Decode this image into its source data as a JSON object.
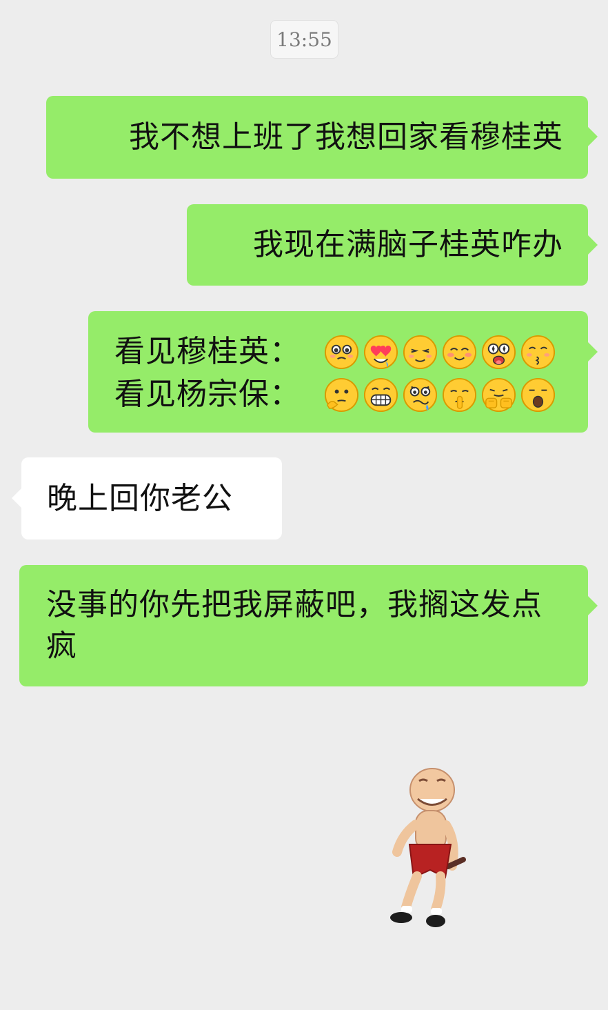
{
  "chat": {
    "timestamp": "13:55",
    "messages": [
      {
        "side": "outgoing",
        "text": "我不想上班了我想回家看穆桂英"
      },
      {
        "side": "outgoing",
        "text": "我现在满脑子桂英咋办"
      },
      {
        "side": "outgoing",
        "lines": [
          {
            "label": "看见穆桂英：",
            "emojis": [
              "pleading-face-icon",
              "heart-eyes-icon",
              "smirk-face-icon",
              "blushing-face-icon",
              "star-eyes-icon",
              "kissing-face-icon"
            ]
          },
          {
            "label": "看见杨宗保：",
            "emojis": [
              "thinking-face-icon",
              "grinning-face-icon",
              "crying-face-icon",
              "shh-face-icon",
              "fist-face-icon",
              "yawning-face-icon"
            ]
          }
        ]
      },
      {
        "side": "incoming",
        "text": "晚上回你老公"
      },
      {
        "side": "outgoing",
        "text": "没事的你先把我屏蔽吧，我搁这发点疯"
      }
    ],
    "sticker": {
      "icon": "dancing-man-sticker"
    }
  },
  "colors": {
    "background": "#ededed",
    "outgoing_bubble": "#95ec69",
    "incoming_bubble": "#ffffff",
    "timestamp_bg": "#f6f6f6",
    "text": "#111111"
  }
}
